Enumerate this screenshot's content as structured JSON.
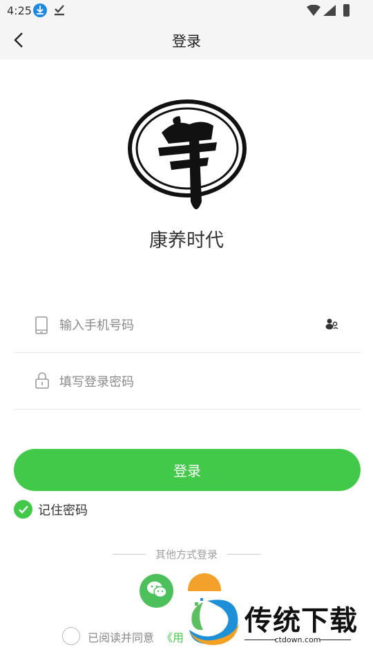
{
  "status_bar": {
    "time": "4:25"
  },
  "header": {
    "title": "登录"
  },
  "brand": {
    "name": "康养时代"
  },
  "form": {
    "phone_placeholder": "输入手机号码",
    "password_placeholder": "填写登录密码"
  },
  "login_button": "登录",
  "remember": {
    "label": "记住密码",
    "checked": true
  },
  "other_login": {
    "title": "其他方式登录"
  },
  "agreement": {
    "text": "已阅读并同意",
    "link": "《用"
  },
  "watermark": {
    "text": "传统下载",
    "sub": "ctdown.com"
  },
  "colors": {
    "accent": "#42c94a",
    "wechat": "#4ec05b",
    "orange": "#f3a12b"
  }
}
